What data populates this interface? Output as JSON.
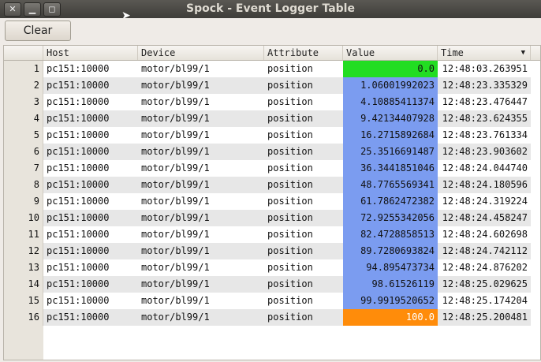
{
  "window": {
    "title": "Spock - Event Logger Table"
  },
  "toolbar": {
    "clear_label": "Clear"
  },
  "table": {
    "columns": [
      "Host",
      "Device",
      "Attribute",
      "Value",
      "Time"
    ],
    "colors": {
      "value_zero": "#22dd22",
      "value_mid": "#7b9cf0",
      "value_max": "#ff8c0a"
    },
    "rows": [
      {
        "n": "1",
        "host": "pc151:10000",
        "device": "motor/bl99/1",
        "attr": "position",
        "value": "0.0",
        "time": "12:48:03.263951",
        "state": "zero"
      },
      {
        "n": "2",
        "host": "pc151:10000",
        "device": "motor/bl99/1",
        "attr": "position",
        "value": "1.06001992023",
        "time": "12:48:23.335329",
        "state": "mid"
      },
      {
        "n": "3",
        "host": "pc151:10000",
        "device": "motor/bl99/1",
        "attr": "position",
        "value": "4.10885411374",
        "time": "12:48:23.476447",
        "state": "mid"
      },
      {
        "n": "4",
        "host": "pc151:10000",
        "device": "motor/bl99/1",
        "attr": "position",
        "value": "9.42134407928",
        "time": "12:48:23.624355",
        "state": "mid"
      },
      {
        "n": "5",
        "host": "pc151:10000",
        "device": "motor/bl99/1",
        "attr": "position",
        "value": "16.2715892684",
        "time": "12:48:23.761334",
        "state": "mid"
      },
      {
        "n": "6",
        "host": "pc151:10000",
        "device": "motor/bl99/1",
        "attr": "position",
        "value": "25.3516691487",
        "time": "12:48:23.903602",
        "state": "mid"
      },
      {
        "n": "7",
        "host": "pc151:10000",
        "device": "motor/bl99/1",
        "attr": "position",
        "value": "36.3441851046",
        "time": "12:48:24.044740",
        "state": "mid"
      },
      {
        "n": "8",
        "host": "pc151:10000",
        "device": "motor/bl99/1",
        "attr": "position",
        "value": "48.7765569341",
        "time": "12:48:24.180596",
        "state": "mid"
      },
      {
        "n": "9",
        "host": "pc151:10000",
        "device": "motor/bl99/1",
        "attr": "position",
        "value": "61.7862472382",
        "time": "12:48:24.319224",
        "state": "mid"
      },
      {
        "n": "10",
        "host": "pc151:10000",
        "device": "motor/bl99/1",
        "attr": "position",
        "value": "72.9255342056",
        "time": "12:48:24.458247",
        "state": "mid"
      },
      {
        "n": "11",
        "host": "pc151:10000",
        "device": "motor/bl99/1",
        "attr": "position",
        "value": "82.4728858513",
        "time": "12:48:24.602698",
        "state": "mid"
      },
      {
        "n": "12",
        "host": "pc151:10000",
        "device": "motor/bl99/1",
        "attr": "position",
        "value": "89.7280693824",
        "time": "12:48:24.742112",
        "state": "mid"
      },
      {
        "n": "13",
        "host": "pc151:10000",
        "device": "motor/bl99/1",
        "attr": "position",
        "value": "94.895473734",
        "time": "12:48:24.876202",
        "state": "mid"
      },
      {
        "n": "14",
        "host": "pc151:10000",
        "device": "motor/bl99/1",
        "attr": "position",
        "value": "98.61526119",
        "time": "12:48:25.029625",
        "state": "mid"
      },
      {
        "n": "15",
        "host": "pc151:10000",
        "device": "motor/bl99/1",
        "attr": "position",
        "value": "99.9919520652",
        "time": "12:48:25.174204",
        "state": "mid"
      },
      {
        "n": "16",
        "host": "pc151:10000",
        "device": "motor/bl99/1",
        "attr": "position",
        "value": "100.0",
        "time": "12:48:25.200481",
        "state": "max"
      }
    ]
  }
}
